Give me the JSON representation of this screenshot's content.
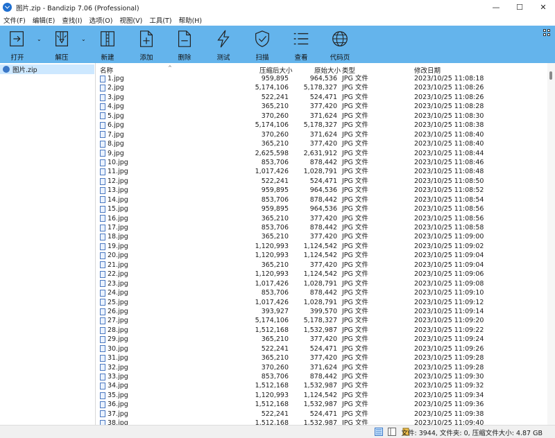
{
  "window": {
    "title": "图片.zip - Bandizip 7.06 (Professional)",
    "minimize": "—",
    "maximize": "☐",
    "close": "✕"
  },
  "menu": [
    "文件(F)",
    "编辑(E)",
    "查找(I)",
    "选项(O)",
    "视图(V)",
    "工具(T)",
    "帮助(H)"
  ],
  "toolbar": {
    "open": "打开",
    "extract": "解压",
    "new": "新建",
    "add": "添加",
    "delete": "删除",
    "test": "测试",
    "scan": "扫描",
    "view": "查看",
    "codepage": "代码页",
    "dropdown_arrow": "⌄"
  },
  "sidebar": {
    "item": "图片.zip"
  },
  "columns": {
    "name": "名称",
    "compressed": "压缩后大小",
    "original": "原始大小",
    "type": "类型",
    "modified": "修改日期",
    "sort_arrow": "^"
  },
  "files": [
    {
      "name": "1.jpg",
      "comp": "959,895",
      "orig": "964,536",
      "type": "JPG 文件",
      "date": "2023/10/25 11:08:18"
    },
    {
      "name": "2.jpg",
      "comp": "5,174,106",
      "orig": "5,178,327",
      "type": "JPG 文件",
      "date": "2023/10/25 11:08:26"
    },
    {
      "name": "3.jpg",
      "comp": "522,241",
      "orig": "524,471",
      "type": "JPG 文件",
      "date": "2023/10/25 11:08:26"
    },
    {
      "name": "4.jpg",
      "comp": "365,210",
      "orig": "377,420",
      "type": "JPG 文件",
      "date": "2023/10/25 11:08:28"
    },
    {
      "name": "5.jpg",
      "comp": "370,260",
      "orig": "371,624",
      "type": "JPG 文件",
      "date": "2023/10/25 11:08:30"
    },
    {
      "name": "6.jpg",
      "comp": "5,174,106",
      "orig": "5,178,327",
      "type": "JPG 文件",
      "date": "2023/10/25 11:08:38"
    },
    {
      "name": "7.jpg",
      "comp": "370,260",
      "orig": "371,624",
      "type": "JPG 文件",
      "date": "2023/10/25 11:08:40"
    },
    {
      "name": "8.jpg",
      "comp": "365,210",
      "orig": "377,420",
      "type": "JPG 文件",
      "date": "2023/10/25 11:08:40"
    },
    {
      "name": "9.jpg",
      "comp": "2,625,598",
      "orig": "2,631,912",
      "type": "JPG 文件",
      "date": "2023/10/25 11:08:44"
    },
    {
      "name": "10.jpg",
      "comp": "853,706",
      "orig": "878,442",
      "type": "JPG 文件",
      "date": "2023/10/25 11:08:46"
    },
    {
      "name": "11.jpg",
      "comp": "1,017,426",
      "orig": "1,028,791",
      "type": "JPG 文件",
      "date": "2023/10/25 11:08:48"
    },
    {
      "name": "12.jpg",
      "comp": "522,241",
      "orig": "524,471",
      "type": "JPG 文件",
      "date": "2023/10/25 11:08:50"
    },
    {
      "name": "13.jpg",
      "comp": "959,895",
      "orig": "964,536",
      "type": "JPG 文件",
      "date": "2023/10/25 11:08:52"
    },
    {
      "name": "14.jpg",
      "comp": "853,706",
      "orig": "878,442",
      "type": "JPG 文件",
      "date": "2023/10/25 11:08:54"
    },
    {
      "name": "15.jpg",
      "comp": "959,895",
      "orig": "964,536",
      "type": "JPG 文件",
      "date": "2023/10/25 11:08:56"
    },
    {
      "name": "16.jpg",
      "comp": "365,210",
      "orig": "377,420",
      "type": "JPG 文件",
      "date": "2023/10/25 11:08:56"
    },
    {
      "name": "17.jpg",
      "comp": "853,706",
      "orig": "878,442",
      "type": "JPG 文件",
      "date": "2023/10/25 11:08:58"
    },
    {
      "name": "18.jpg",
      "comp": "365,210",
      "orig": "377,420",
      "type": "JPG 文件",
      "date": "2023/10/25 11:09:00"
    },
    {
      "name": "19.jpg",
      "comp": "1,120,993",
      "orig": "1,124,542",
      "type": "JPG 文件",
      "date": "2023/10/25 11:09:02"
    },
    {
      "name": "20.jpg",
      "comp": "1,120,993",
      "orig": "1,124,542",
      "type": "JPG 文件",
      "date": "2023/10/25 11:09:04"
    },
    {
      "name": "21.jpg",
      "comp": "365,210",
      "orig": "377,420",
      "type": "JPG 文件",
      "date": "2023/10/25 11:09:04"
    },
    {
      "name": "22.jpg",
      "comp": "1,120,993",
      "orig": "1,124,542",
      "type": "JPG 文件",
      "date": "2023/10/25 11:09:06"
    },
    {
      "name": "23.jpg",
      "comp": "1,017,426",
      "orig": "1,028,791",
      "type": "JPG 文件",
      "date": "2023/10/25 11:09:08"
    },
    {
      "name": "24.jpg",
      "comp": "853,706",
      "orig": "878,442",
      "type": "JPG 文件",
      "date": "2023/10/25 11:09:10"
    },
    {
      "name": "25.jpg",
      "comp": "1,017,426",
      "orig": "1,028,791",
      "type": "JPG 文件",
      "date": "2023/10/25 11:09:12"
    },
    {
      "name": "26.jpg",
      "comp": "393,927",
      "orig": "399,570",
      "type": "JPG 文件",
      "date": "2023/10/25 11:09:14"
    },
    {
      "name": "27.jpg",
      "comp": "5,174,106",
      "orig": "5,178,327",
      "type": "JPG 文件",
      "date": "2023/10/25 11:09:20"
    },
    {
      "name": "28.jpg",
      "comp": "1,512,168",
      "orig": "1,532,987",
      "type": "JPG 文件",
      "date": "2023/10/25 11:09:22"
    },
    {
      "name": "29.jpg",
      "comp": "365,210",
      "orig": "377,420",
      "type": "JPG 文件",
      "date": "2023/10/25 11:09:24"
    },
    {
      "name": "30.jpg",
      "comp": "522,241",
      "orig": "524,471",
      "type": "JPG 文件",
      "date": "2023/10/25 11:09:26"
    },
    {
      "name": "31.jpg",
      "comp": "365,210",
      "orig": "377,420",
      "type": "JPG 文件",
      "date": "2023/10/25 11:09:28"
    },
    {
      "name": "32.jpg",
      "comp": "370,260",
      "orig": "371,624",
      "type": "JPG 文件",
      "date": "2023/10/25 11:09:28"
    },
    {
      "name": "33.jpg",
      "comp": "853,706",
      "orig": "878,442",
      "type": "JPG 文件",
      "date": "2023/10/25 11:09:30"
    },
    {
      "name": "34.jpg",
      "comp": "1,512,168",
      "orig": "1,532,987",
      "type": "JPG 文件",
      "date": "2023/10/25 11:09:32"
    },
    {
      "name": "35.jpg",
      "comp": "1,120,993",
      "orig": "1,124,542",
      "type": "JPG 文件",
      "date": "2023/10/25 11:09:34"
    },
    {
      "name": "36.jpg",
      "comp": "1,512,168",
      "orig": "1,532,987",
      "type": "JPG 文件",
      "date": "2023/10/25 11:09:36"
    },
    {
      "name": "37.jpg",
      "comp": "522,241",
      "orig": "524,471",
      "type": "JPG 文件",
      "date": "2023/10/25 11:09:38"
    },
    {
      "name": "38.jpg",
      "comp": "1,512,168",
      "orig": "1,532,987",
      "type": "JPG 文件",
      "date": "2023/10/25 11:09:40"
    }
  ],
  "status": {
    "text": "文件: 3944, 文件夹: 0, 压缩文件大小: 4.87 GB"
  },
  "colors": {
    "toolbar_bg": "#64b4ec",
    "selection": "#cde8ff",
    "app_icon": "#1f6fd0"
  }
}
